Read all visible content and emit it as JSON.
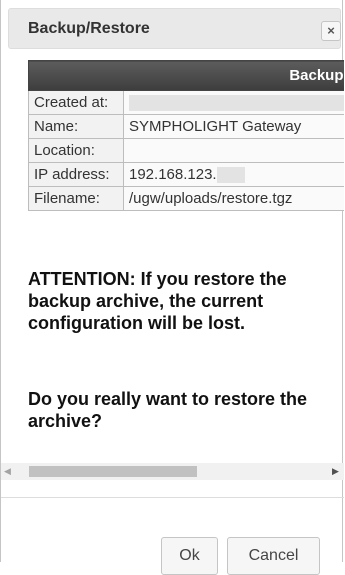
{
  "dialog": {
    "title": "Backup/Restore",
    "close_icon": "close-icon",
    "close_glyph": "×"
  },
  "info_table": {
    "header": "Backup infor",
    "rows": [
      {
        "label": "Created at:",
        "value": ""
      },
      {
        "label": "Name:",
        "value": "SYMPHOLIGHT Gateway"
      },
      {
        "label": "Location:",
        "value": ""
      },
      {
        "label": "IP address:",
        "value": "192.168.123."
      },
      {
        "label": "Filename:",
        "value": "/ugw/uploads/restore.tgz"
      }
    ]
  },
  "messages": {
    "attention": "ATTENTION: If you restore the backup archive, the current configuration will be lost.",
    "question": "Do you really want to restore the archive?"
  },
  "scrollbar": {
    "left_icon": "chevron-left-icon",
    "right_icon": "chevron-right-icon"
  },
  "buttons": {
    "ok": "Ok",
    "cancel": "Cancel"
  }
}
